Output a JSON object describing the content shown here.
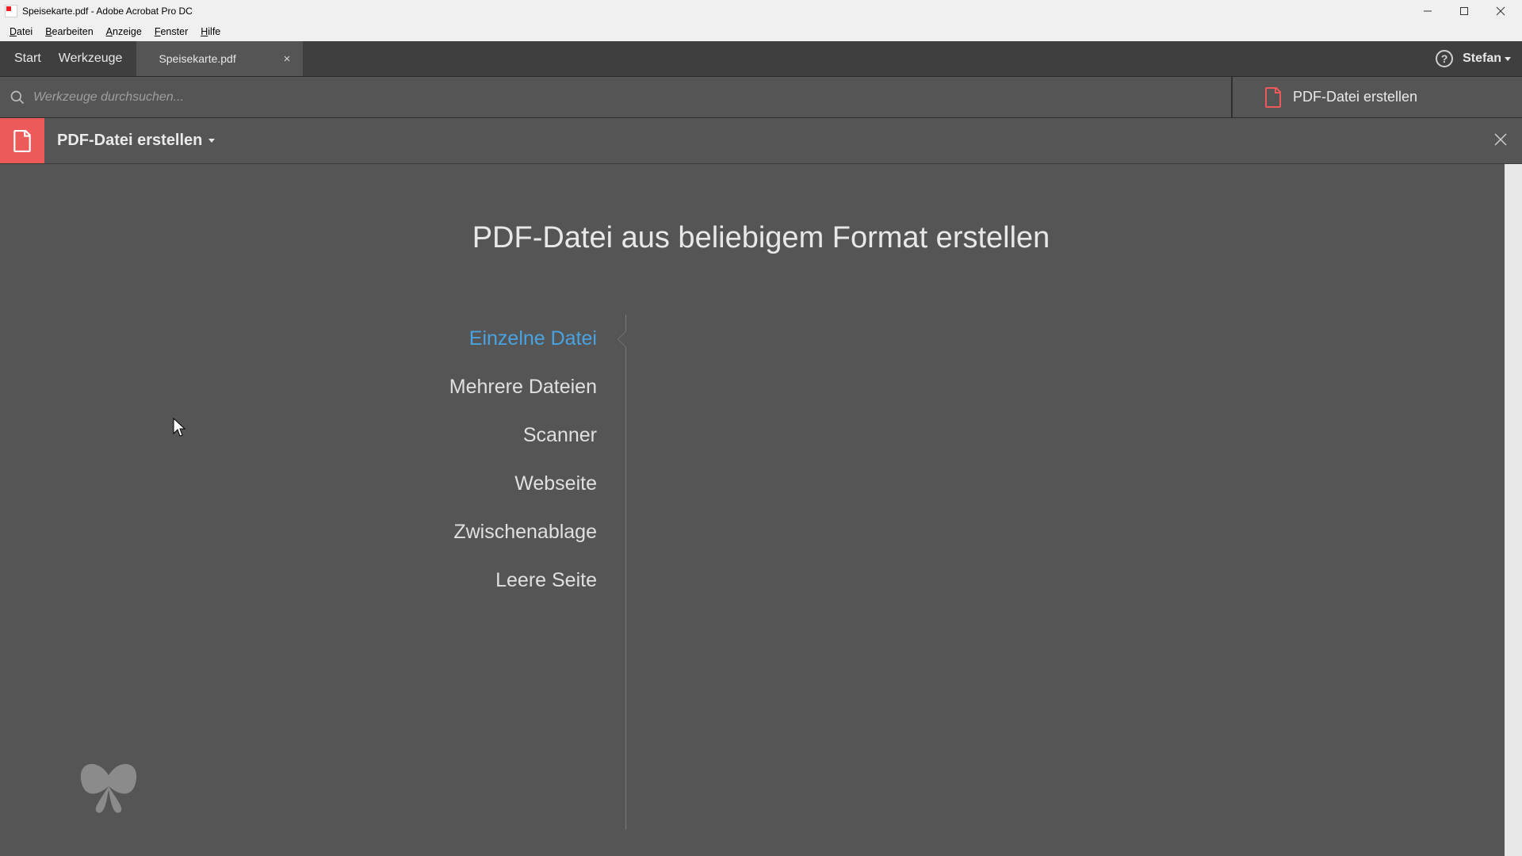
{
  "window": {
    "title": "Speisekarte.pdf - Adobe Acrobat Pro DC"
  },
  "menu": {
    "items": [
      "Datei",
      "Bearbeiten",
      "Anzeige",
      "Fenster",
      "Hilfe"
    ]
  },
  "tabs": {
    "start": "Start",
    "tools": "Werkzeuge",
    "doc_name": "Speisekarte.pdf"
  },
  "user": {
    "name": "Stefan"
  },
  "search": {
    "placeholder": "Werkzeuge durchsuchen..."
  },
  "side_tool": {
    "label": "PDF-Datei erstellen"
  },
  "tool_header": {
    "title": "PDF-Datei erstellen"
  },
  "main": {
    "heading": "PDF-Datei aus beliebigem Format erstellen",
    "options": [
      "Einzelne Datei",
      "Mehrere Dateien",
      "Scanner",
      "Webseite",
      "Zwischenablage",
      "Leere Seite"
    ],
    "active_index": 0
  }
}
